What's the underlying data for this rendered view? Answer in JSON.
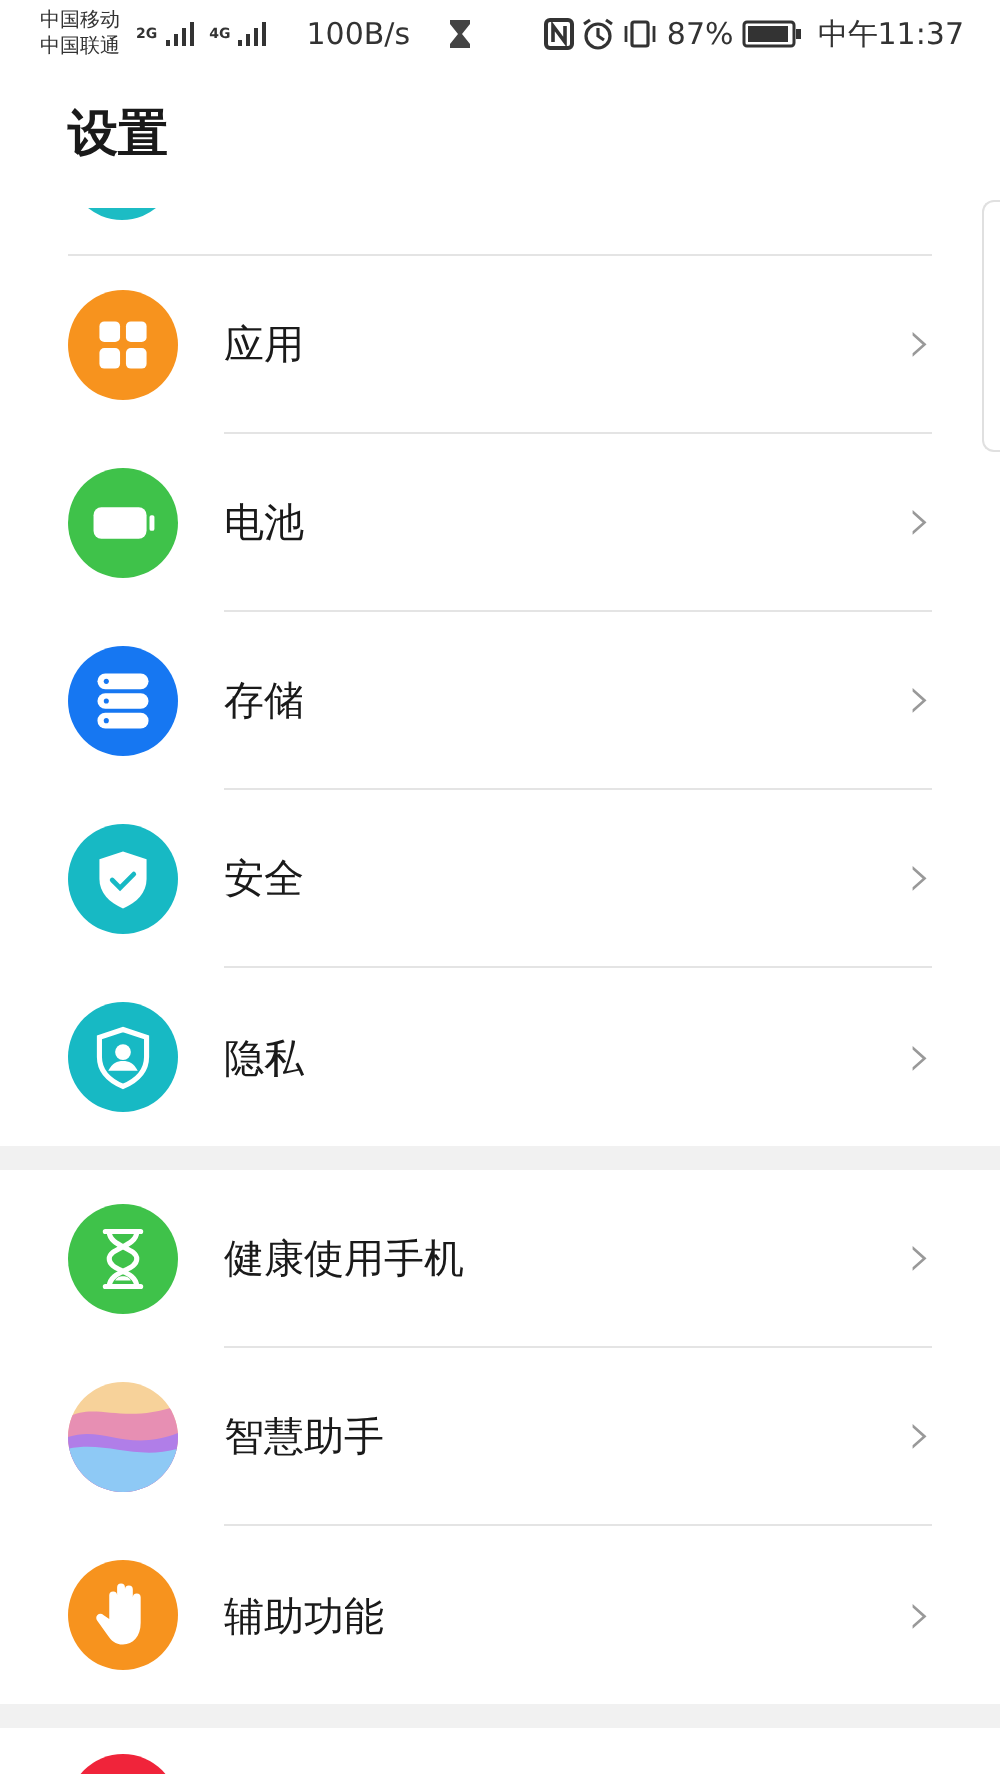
{
  "status_bar": {
    "carriers": [
      "中国移动",
      "中国联通"
    ],
    "network_types": [
      "2G",
      "4G"
    ],
    "speed": "100B/s",
    "battery_percent": "87%",
    "time": "中午11:37"
  },
  "title": "设置",
  "groups": [
    {
      "items": [
        {
          "label": "应用",
          "chevron": "›"
        },
        {
          "label": "电池",
          "chevron": "›"
        },
        {
          "label": "存储",
          "chevron": "›"
        },
        {
          "label": "安全",
          "chevron": "›"
        },
        {
          "label": "隐私",
          "chevron": "›"
        }
      ]
    },
    {
      "items": [
        {
          "label": "健康使用手机",
          "chevron": "›"
        },
        {
          "label": "智慧助手",
          "chevron": "›"
        },
        {
          "label": "辅助功能",
          "chevron": "›"
        }
      ]
    }
  ]
}
